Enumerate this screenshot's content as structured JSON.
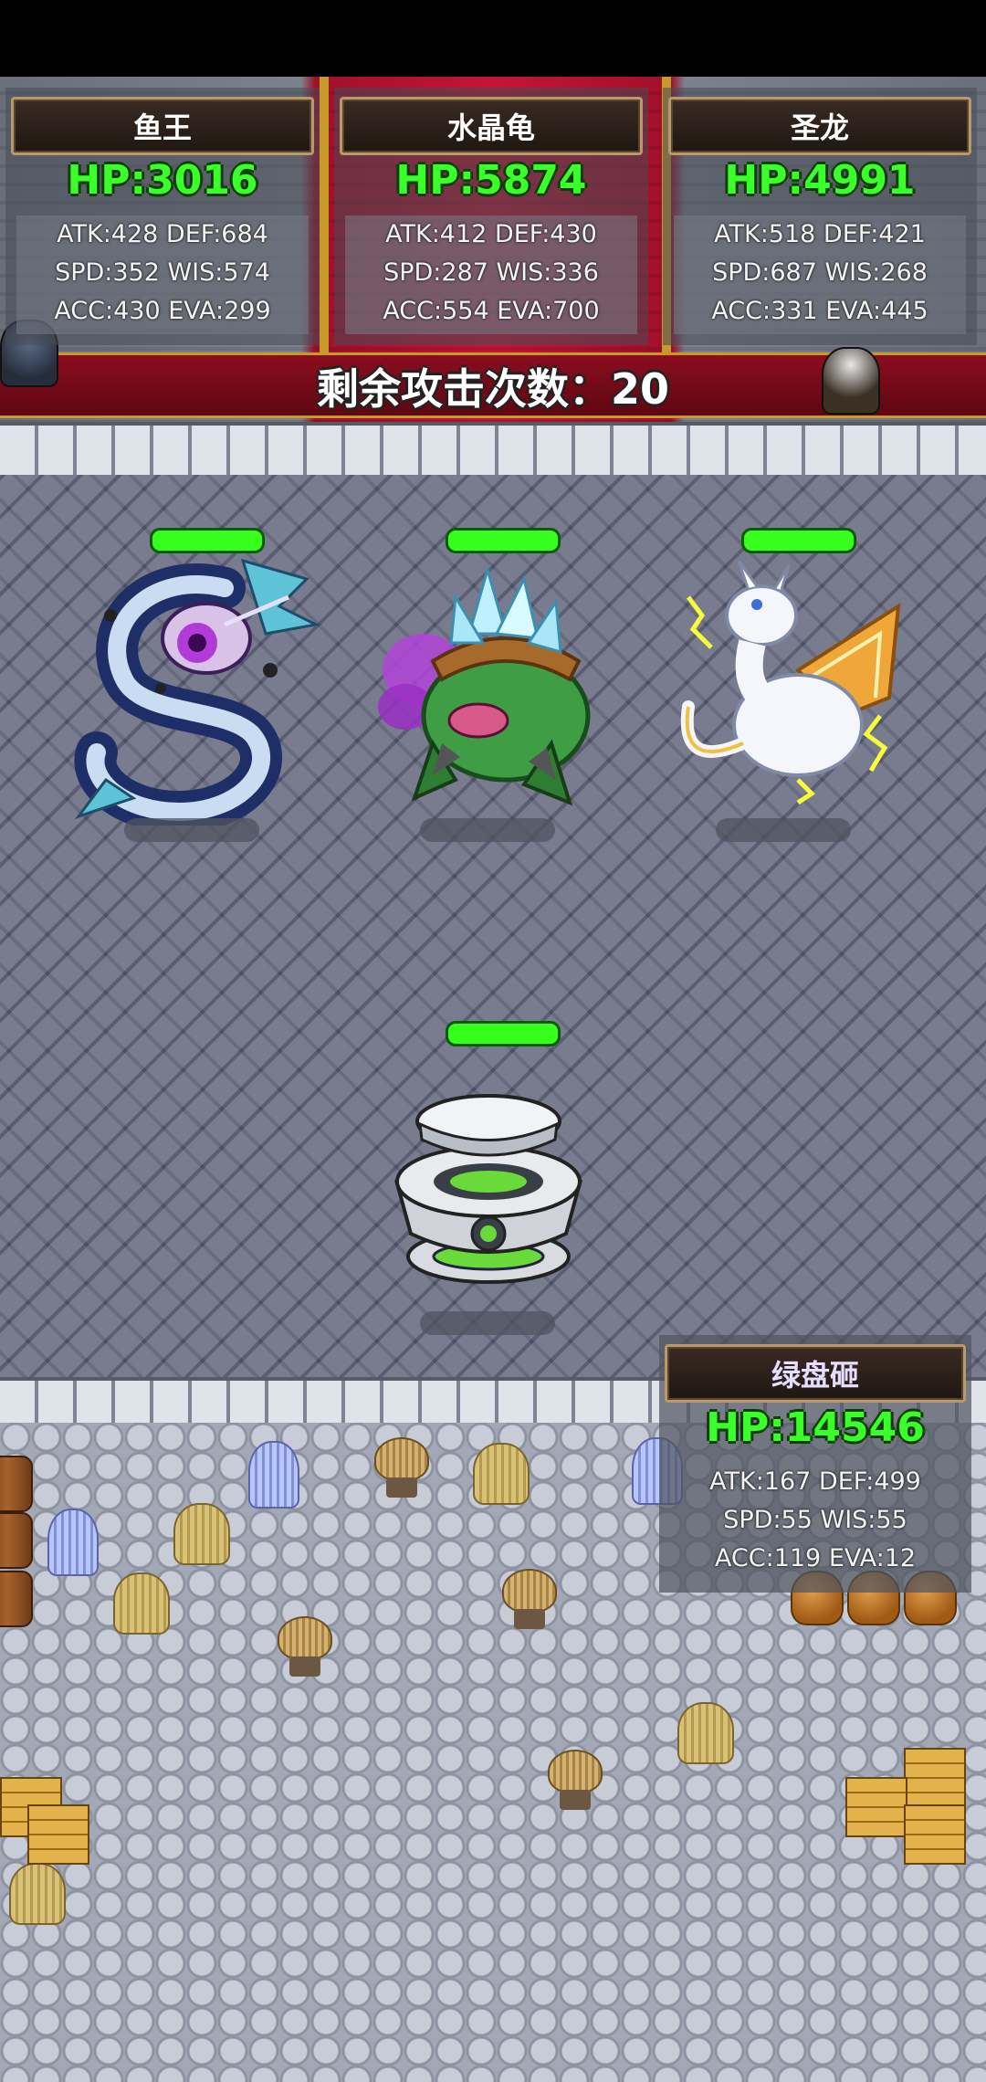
{
  "battle": {
    "remaining_attacks_label": "剩余攻击次数：20",
    "enemies": [
      {
        "name": "鱼王",
        "hp": "HP:3016",
        "stats": [
          "ATK:428 DEF:684",
          "SPD:352 WIS:574",
          "ACC:430 EVA:299"
        ],
        "hp_fraction": 1.0
      },
      {
        "name": "水晶龟",
        "hp": "HP:5874",
        "stats": [
          "ATK:412 DEF:430",
          "SPD:287 WIS:336",
          "ACC:554 EVA:700"
        ],
        "hp_fraction": 1.0
      },
      {
        "name": "圣龙",
        "hp": "HP:4991",
        "stats": [
          "ATK:518 DEF:421",
          "SPD:687 WIS:268",
          "ACC:331 EVA:445"
        ],
        "hp_fraction": 1.0
      }
    ],
    "player": {
      "name": "绿盘砸",
      "hp": "HP:14546",
      "stats": [
        "ATK:167 DEF:499",
        "SPD:55 WIS:55",
        "ACC:119 EVA:12"
      ],
      "hp_fraction": 1.0
    }
  },
  "colors": {
    "hp_text": "#3bff2a",
    "hp_bar": "#36ff1e",
    "carpet": "#c31634",
    "name_plate": "#2b1f18"
  },
  "icons": {
    "enemy_1": "sea-serpent-dragon-icon",
    "enemy_2": "crystal-turtle-icon",
    "enemy_3": "holy-white-dragon-icon",
    "player": "green-disc-robot-icon"
  }
}
